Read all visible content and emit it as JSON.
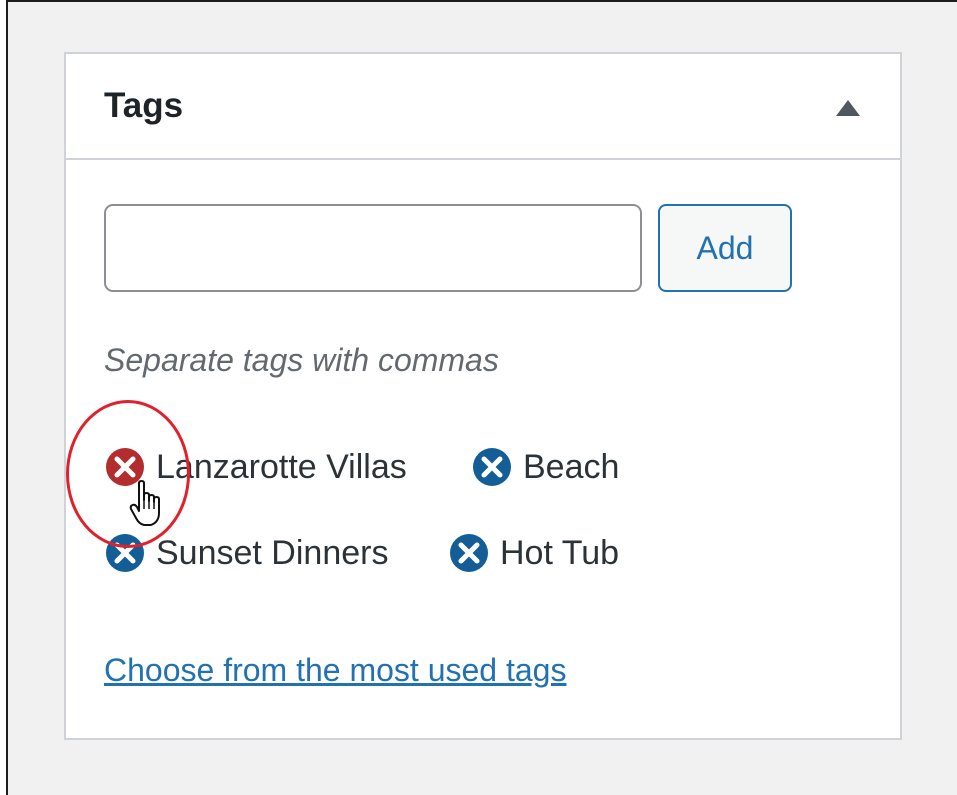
{
  "metabox": {
    "title": "Tags",
    "toggle_icon": "triangle-up-icon"
  },
  "input": {
    "value": "",
    "placeholder": ""
  },
  "add_button": {
    "label": "Add"
  },
  "hint": "Separate tags with commas",
  "tags": [
    {
      "label": "Lanzarotte Villas",
      "remove_icon": "remove-circle-icon",
      "state": "hover"
    },
    {
      "label": "Beach",
      "remove_icon": "remove-circle-icon",
      "state": "normal"
    },
    {
      "label": "Sunset Dinners",
      "remove_icon": "remove-circle-icon",
      "state": "normal"
    },
    {
      "label": "Hot Tub",
      "remove_icon": "remove-circle-icon",
      "state": "normal"
    }
  ],
  "most_used_link": "Choose from the most used tags",
  "colors": {
    "accent": "#2271b1",
    "remove_normal": "#135e96",
    "remove_hover": "#b32d2e",
    "annotation": "#e0202a"
  }
}
